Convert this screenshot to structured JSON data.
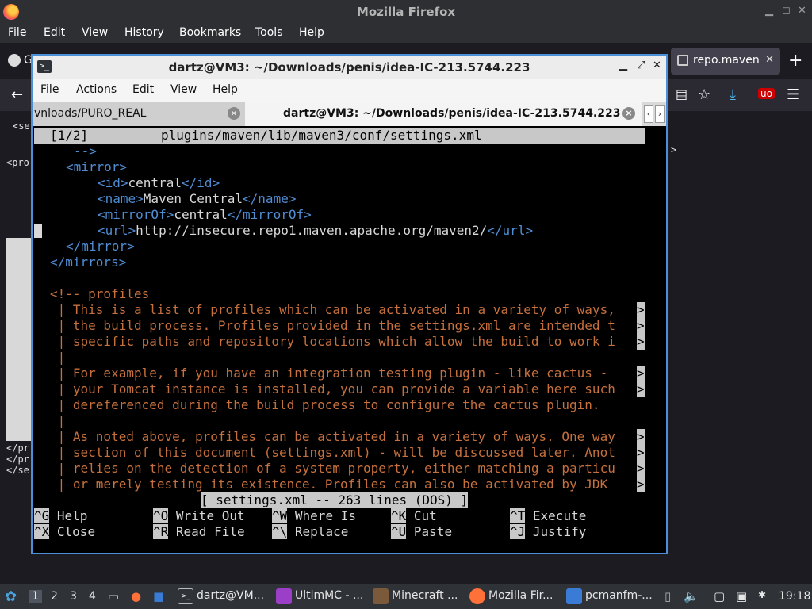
{
  "firefox": {
    "window_title": "Mozilla Firefox",
    "menu": [
      "File",
      "Edit",
      "View",
      "History",
      "Bookmarks",
      "Tools",
      "Help"
    ],
    "tab_label": "repo.maven",
    "content_fragments": [
      "<se",
      "<pro",
      ">",
      "</pr",
      "</pr",
      "</se"
    ]
  },
  "terminal": {
    "window_title": "dartz@VM3: ~/Downloads/penis/idea-IC-213.5744.223",
    "menu": [
      "File",
      "Actions",
      "Edit",
      "View",
      "Help"
    ],
    "tabs": [
      {
        "label": "vnloads/PURO_REAL"
      },
      {
        "label": "dartz@VM3: ~/Downloads/penis/idea-IC-213.5744.223"
      }
    ],
    "nano": {
      "header_left": "[1/2]",
      "header_file": "plugins/maven/lib/maven3/conf/settings.xml",
      "status": "[ settings.xml -- 263 lines (DOS) ]",
      "shortcuts_row1": [
        {
          "key": "^G",
          "label": "Help"
        },
        {
          "key": "^O",
          "label": "Write Out"
        },
        {
          "key": "^W",
          "label": "Where Is"
        },
        {
          "key": "^K",
          "label": "Cut"
        },
        {
          "key": "^T",
          "label": "Execute"
        }
      ],
      "shortcuts_row2": [
        {
          "key": "^X",
          "label": "Close"
        },
        {
          "key": "^R",
          "label": "Read File"
        },
        {
          "key": "^\\",
          "label": "Replace"
        },
        {
          "key": "^U",
          "label": "Paste"
        },
        {
          "key": "^J",
          "label": "Justify"
        }
      ],
      "comment_lines": [
        "<!-- profiles",
        " | This is a list of profiles which can be activated in a variety of ways,",
        " | the build process. Profiles provided in the settings.xml are intended t",
        " | specific paths and repository locations which allow the build to work i",
        " |",
        " | For example, if you have an integration testing plugin - like cactus -",
        " | your Tomcat instance is installed, you can provide a variable here such",
        " | dereferenced during the build process to configure the cactus plugin.",
        " |",
        " | As noted above, profiles can be activated in a variety of ways. One way",
        " | section of this document (settings.xml) - will be discussed later. Anot",
        " | relies on the detection of a system property, either matching a particu",
        " | or merely testing its existence. Profiles can also be activated by JDK"
      ],
      "xml": {
        "comment_end": "-->",
        "mirror_open": "<mirror>",
        "id_open": "<id>",
        "id_value": "central",
        "id_close": "</id>",
        "name_open": "<name>",
        "name_value": "Maven Central",
        "name_close": "</name>",
        "mirrorof_open": "<mirrorOf>",
        "mirrorof_value": "central",
        "mirrorof_close": "</mirrorOf>",
        "url_open": "<url>",
        "url_value": "http://insecure.repo1.maven.apache.org/maven2/",
        "url_close": "</url>",
        "mirror_close": "</mirror>",
        "mirrors_close": "</mirrors>"
      },
      "overflow_marker": ">"
    }
  },
  "taskbar": {
    "workspaces": [
      "1",
      "2",
      "3",
      "4"
    ],
    "tasks": [
      {
        "label": "dartz@VM...",
        "color": "#2f3338"
      },
      {
        "label": "UltimMC - ...",
        "color": "#9b3fc9"
      },
      {
        "label": "Minecraft ...",
        "color": "#7a5a3a"
      },
      {
        "label": "Mozilla Fir...",
        "color": "#ff7139"
      },
      {
        "label": "pcmanfm-...",
        "color": "#3a7bd5"
      }
    ],
    "clock": "19:18"
  },
  "colors": {
    "terminal_border": "#4a90d9",
    "xml_tag": "#4f8cd2",
    "comment": "#c6703d"
  }
}
